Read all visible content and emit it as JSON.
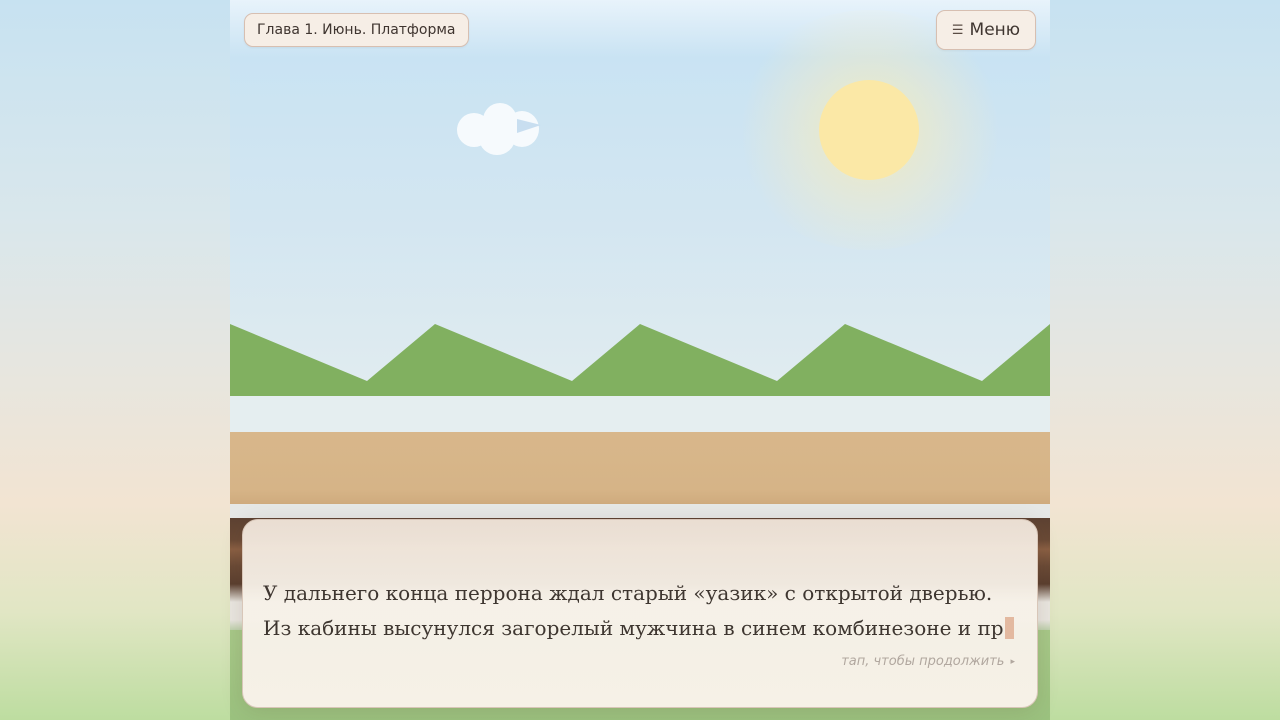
{
  "chapter_title": "Глава 1. Июнь. Платформа",
  "menu": {
    "icon": "menu-icon",
    "label": "Меню"
  },
  "dialogue": {
    "text": "У дальнего конца перрона ждал старый «уазик» с открытой дверью. Из кабины высунулся загорелый мужчина в синем комбинезоне и пр",
    "continue_hint": "тап, чтобы продолжить",
    "continue_icon": "play-arrow-icon"
  },
  "colors": {
    "sky": "#c9e3f3",
    "sun": "#fbe8a6",
    "hills": "#81b060",
    "platform": "#d8b78b",
    "dialog_bg": "#f6f1e7",
    "caret": "#e3b9a0"
  }
}
